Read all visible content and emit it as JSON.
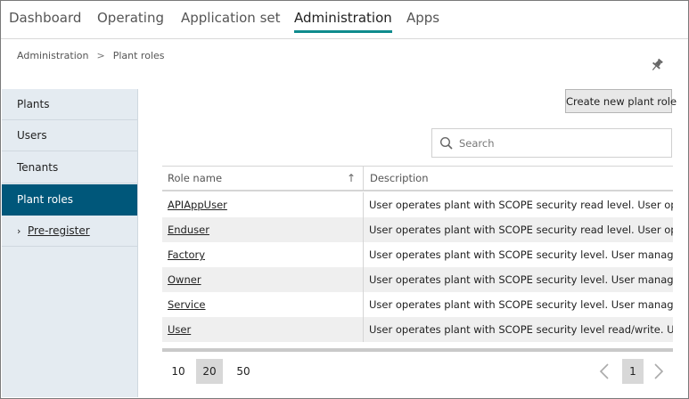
{
  "nav": {
    "tabs": [
      {
        "label": "Dashboard"
      },
      {
        "label": "Operating"
      },
      {
        "label": "Application set"
      },
      {
        "label": "Administration"
      },
      {
        "label": "Apps"
      }
    ],
    "active": "Administration",
    "accent": "#0f8b8d"
  },
  "breadcrumb": {
    "items": [
      "Administration",
      "Plant roles"
    ],
    "separator": ">"
  },
  "sidebar": {
    "items": [
      {
        "label": "Plants"
      },
      {
        "label": "Users"
      },
      {
        "label": "Tenants"
      },
      {
        "label": "Plant roles"
      },
      {
        "label": "Pre-register",
        "chevron": "›"
      }
    ],
    "active": "Plant roles",
    "active_color": "#00577a"
  },
  "toolbar": {
    "create_label": "Create new plant role"
  },
  "search": {
    "placeholder": "Search",
    "value": ""
  },
  "table": {
    "columns": [
      "Role name",
      "Description"
    ],
    "sort_indicator": "↑",
    "rows": [
      {
        "name": "APIAppUser",
        "description": "User operates plant with SCOPE security read level. User operates plant"
      },
      {
        "name": "Enduser",
        "description": "User operates plant with SCOPE security read level. User operates plant"
      },
      {
        "name": "Factory",
        "description": "User operates plant with SCOPE security level.  User manages user"
      },
      {
        "name": "Owner",
        "description": "User operates plant with SCOPE security level.  User manages user"
      },
      {
        "name": "Service",
        "description": "User operates plant with SCOPE security level. User manages plant"
      },
      {
        "name": "User",
        "description": "User operates plant with SCOPE security level read/write. User operates"
      }
    ]
  },
  "pagination": {
    "page_sizes": [
      "10",
      "20",
      "50"
    ],
    "selected_size": "20",
    "current_page": "1"
  }
}
